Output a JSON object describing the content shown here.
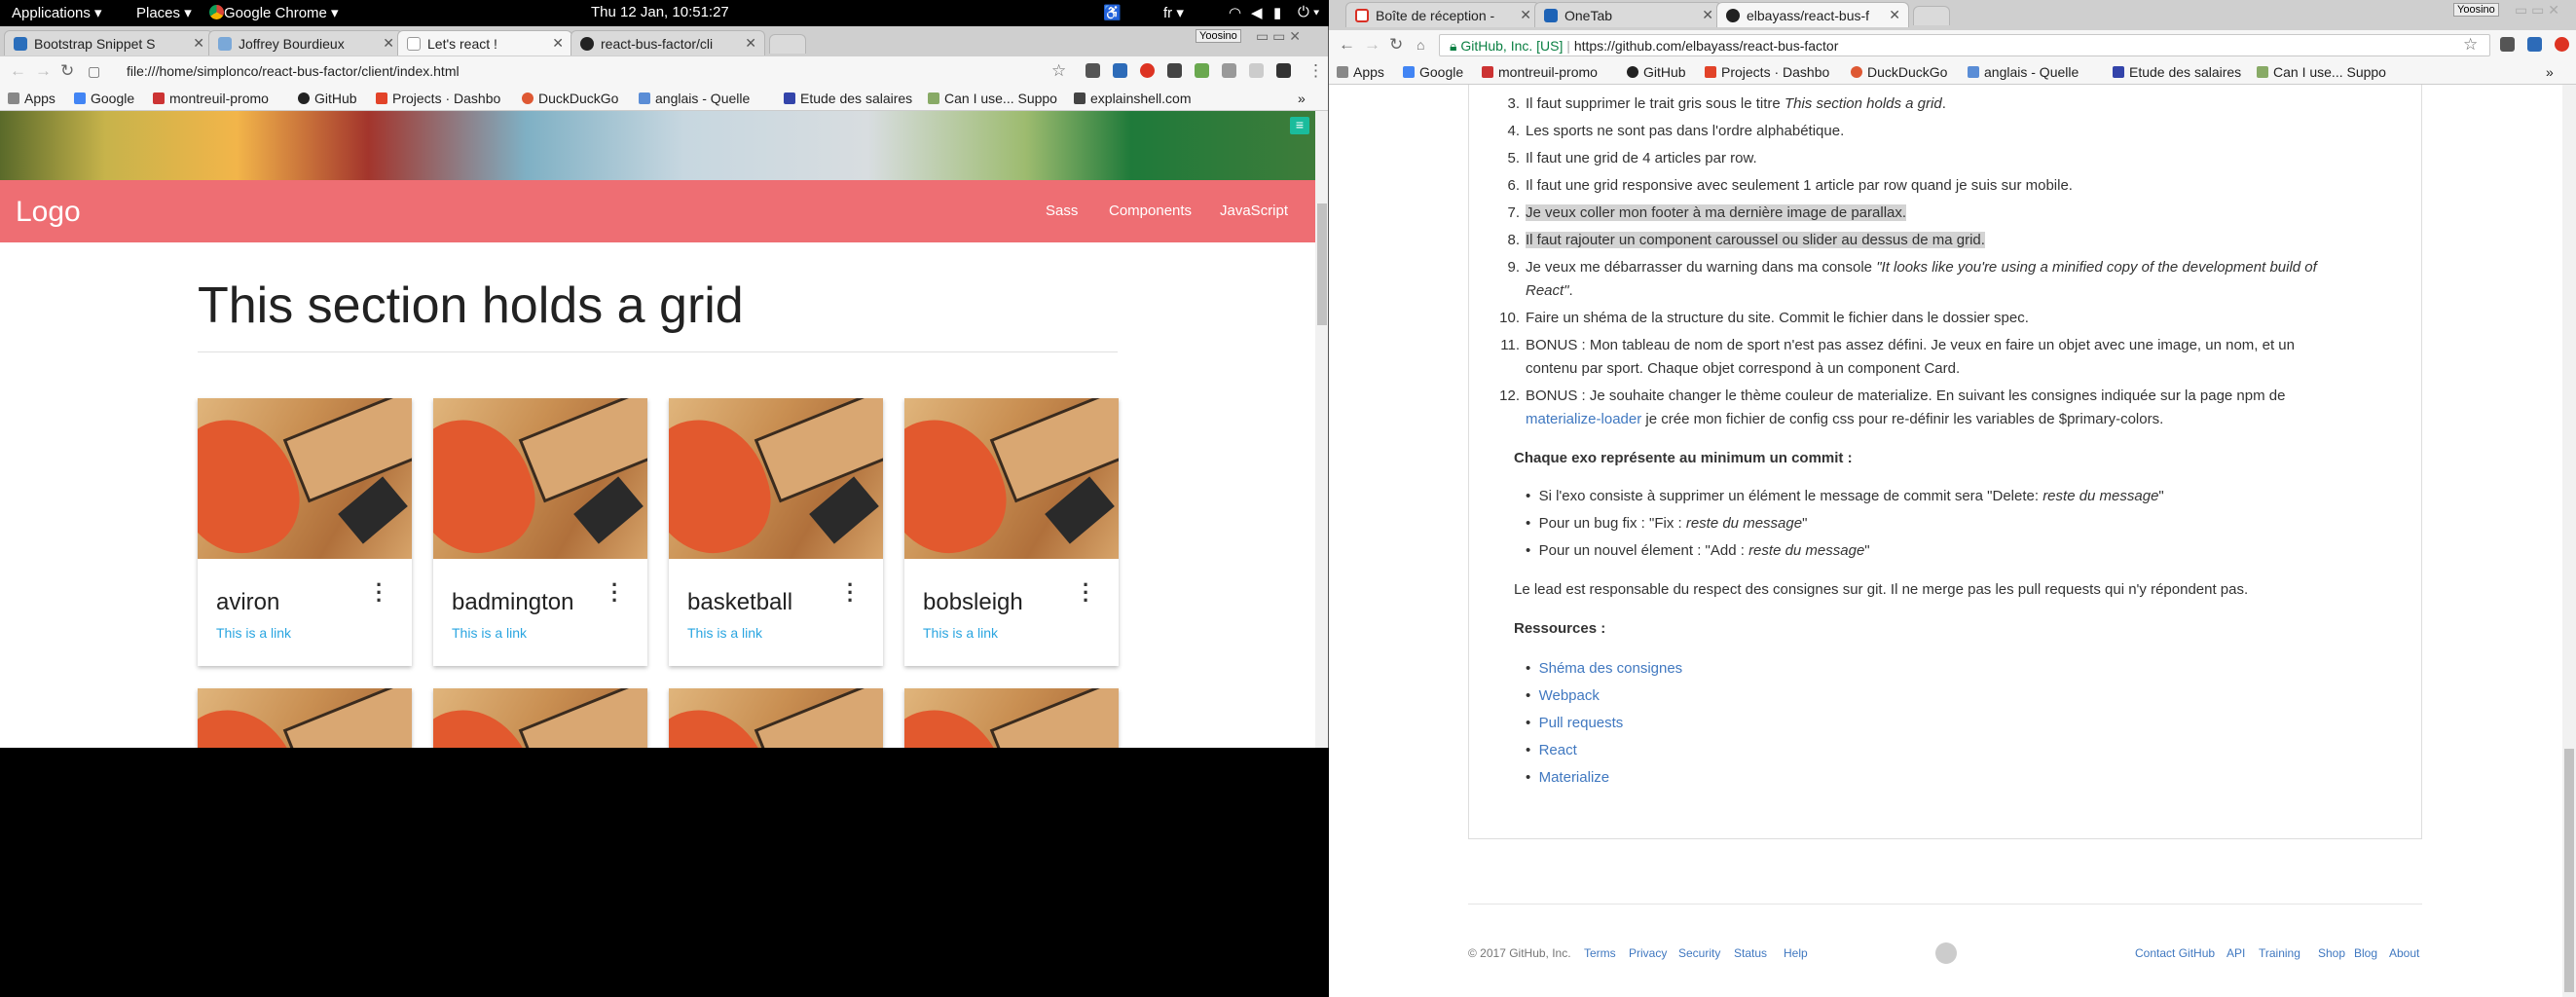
{
  "topbar": {
    "applications": "Applications",
    "places": "Places",
    "app": "Google Chrome",
    "clock": "Thu 12 Jan, 10:51:27",
    "lang": "fr"
  },
  "left": {
    "tabs": [
      {
        "label": "Bootstrap Snippet S"
      },
      {
        "label": "Joffrey Bourdieux"
      },
      {
        "label": "Let's react !"
      },
      {
        "label": "react-bus-factor/cli"
      }
    ],
    "user": "Yoosino",
    "url": "file:///home/simplonco/react-bus-factor/client/index.html",
    "bookmarks": [
      "Apps",
      "Google",
      "montreuil-promo",
      "GitHub",
      "Projects · Dashbo",
      "DuckDuckGo",
      "anglais - Quelle",
      "Etude des salaires",
      "Can I use... Suppo",
      "explainshell.com"
    ],
    "more": "»",
    "nav": {
      "logo": "Logo",
      "links": [
        "Sass",
        "Components",
        "JavaScript"
      ]
    },
    "section_title": "This section holds a grid",
    "cards": [
      {
        "title": "aviron",
        "link": "This is a link"
      },
      {
        "title": "badmington",
        "link": "This is a link"
      },
      {
        "title": "basketball",
        "link": "This is a link"
      },
      {
        "title": "bobsleigh",
        "link": "This is a link"
      }
    ]
  },
  "right": {
    "tabs": [
      {
        "label": "Boîte de réception -"
      },
      {
        "label": "OneTab"
      },
      {
        "label": "elbayass/react-bus-f"
      }
    ],
    "user": "Yoosino",
    "secure": "GitHub, Inc. [US]",
    "url": "https://github.com/elbayass/react-bus-factor",
    "bookmarks": [
      "Apps",
      "Google",
      "montreuil-promo",
      "GitHub",
      "Projects · Dashbo",
      "DuckDuckGo",
      "anglais - Quelle",
      "Etude des salaires",
      "Can I use... Suppo"
    ],
    "more": "»",
    "list": [
      {
        "n": "3.",
        "text": "Il faut supprimer le trait gris sous le titre ",
        "em": "This section holds a grid",
        "after": "."
      },
      {
        "n": "4.",
        "text": "Les sports ne sont pas dans l'ordre alphabétique."
      },
      {
        "n": "5.",
        "text": "Il faut une grid de 4 articles par row."
      },
      {
        "n": "6.",
        "text": "Il faut une grid responsive avec seulement 1 article par row quand je suis sur mobile."
      },
      {
        "n": "7.",
        "text": "Je veux coller mon footer à ma dernière image de parallax."
      },
      {
        "n": "8.",
        "text": "Il faut rajouter un component caroussel ou slider au dessus de ma grid."
      },
      {
        "n": "9.",
        "text": "Je veux me débarrasser du warning dans ma console ",
        "em": "\"It looks like you're using a minified copy of the development build of",
        "em2": "React\"",
        "after": "."
      },
      {
        "n": "10.",
        "text": "Faire un shéma de la structure du site. Commit le fichier dans le dossier spec."
      },
      {
        "n": "11.",
        "text": "BONUS : Mon tableau de nom de sport n'est pas assez défini. Je veux en faire un objet avec une image, un nom, et un",
        "text2": "contenu par sport. Chaque objet correspond à un component Card."
      },
      {
        "n": "12.",
        "text": "BONUS : Je souhaite changer le thème couleur de materialize. En suivant les consignes indiquée sur la page npm de",
        "link": "materialize-loader",
        "text2": " je crée mon fichier de config css pour re-définir les variables de $primary-colors."
      }
    ],
    "commit_heading": "Chaque exo représente au minimum un commit :",
    "bullets": [
      {
        "text": "Si l'exo consiste à supprimer un élément le message de commit sera \"Delete: ",
        "em": "reste du message",
        "after": "\""
      },
      {
        "text": "Pour un bug fix : \"Fix : ",
        "em": "reste du message",
        "after": "\""
      },
      {
        "text": "Pour un nouvel élement : \"Add : ",
        "em": "reste du message",
        "after": "\""
      }
    ],
    "lead": "Le lead est responsable du respect des consignes sur git. Il ne merge pas les pull requests qui n'y répondent pas.",
    "resources_heading": "Ressources :",
    "resources": [
      "Shéma des consignes",
      "Webpack",
      "Pull requests",
      "React",
      "Materialize"
    ],
    "footer": {
      "copy": "© 2017 GitHub, Inc.",
      "left": [
        "Terms",
        "Privacy",
        "Security",
        "Status",
        "Help"
      ],
      "right": [
        "Contact GitHub",
        "API",
        "Training",
        "Shop",
        "Blog",
        "About"
      ]
    }
  }
}
